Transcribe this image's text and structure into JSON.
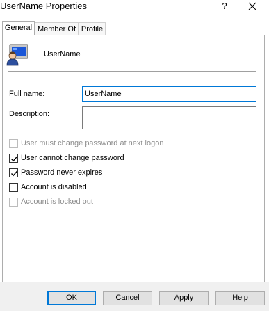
{
  "window": {
    "title": "UserName Properties",
    "help_glyph": "?"
  },
  "tabs": [
    {
      "label": "General",
      "active": true
    },
    {
      "label": "Member Of",
      "active": false
    },
    {
      "label": "Profile",
      "active": false
    }
  ],
  "header": {
    "icon": "user-account-icon",
    "username": "UserName"
  },
  "form": {
    "full_name_label": "Full name:",
    "full_name_value": "UserName",
    "description_label": "Description:",
    "description_value": ""
  },
  "checkboxes": [
    {
      "label": "User must change password at next logon",
      "checked": false,
      "enabled": false
    },
    {
      "label": "User cannot change password",
      "checked": true,
      "enabled": true
    },
    {
      "label": "Password never expires",
      "checked": true,
      "enabled": true
    },
    {
      "label": "Account is disabled",
      "checked": false,
      "enabled": true
    },
    {
      "label": "Account is locked out",
      "checked": false,
      "enabled": false
    }
  ],
  "buttons": {
    "ok": "OK",
    "cancel": "Cancel",
    "apply": "Apply",
    "help": "Help"
  },
  "colors": {
    "focus_accent": "#0078d7",
    "icon_screen": "#1a56d8"
  }
}
